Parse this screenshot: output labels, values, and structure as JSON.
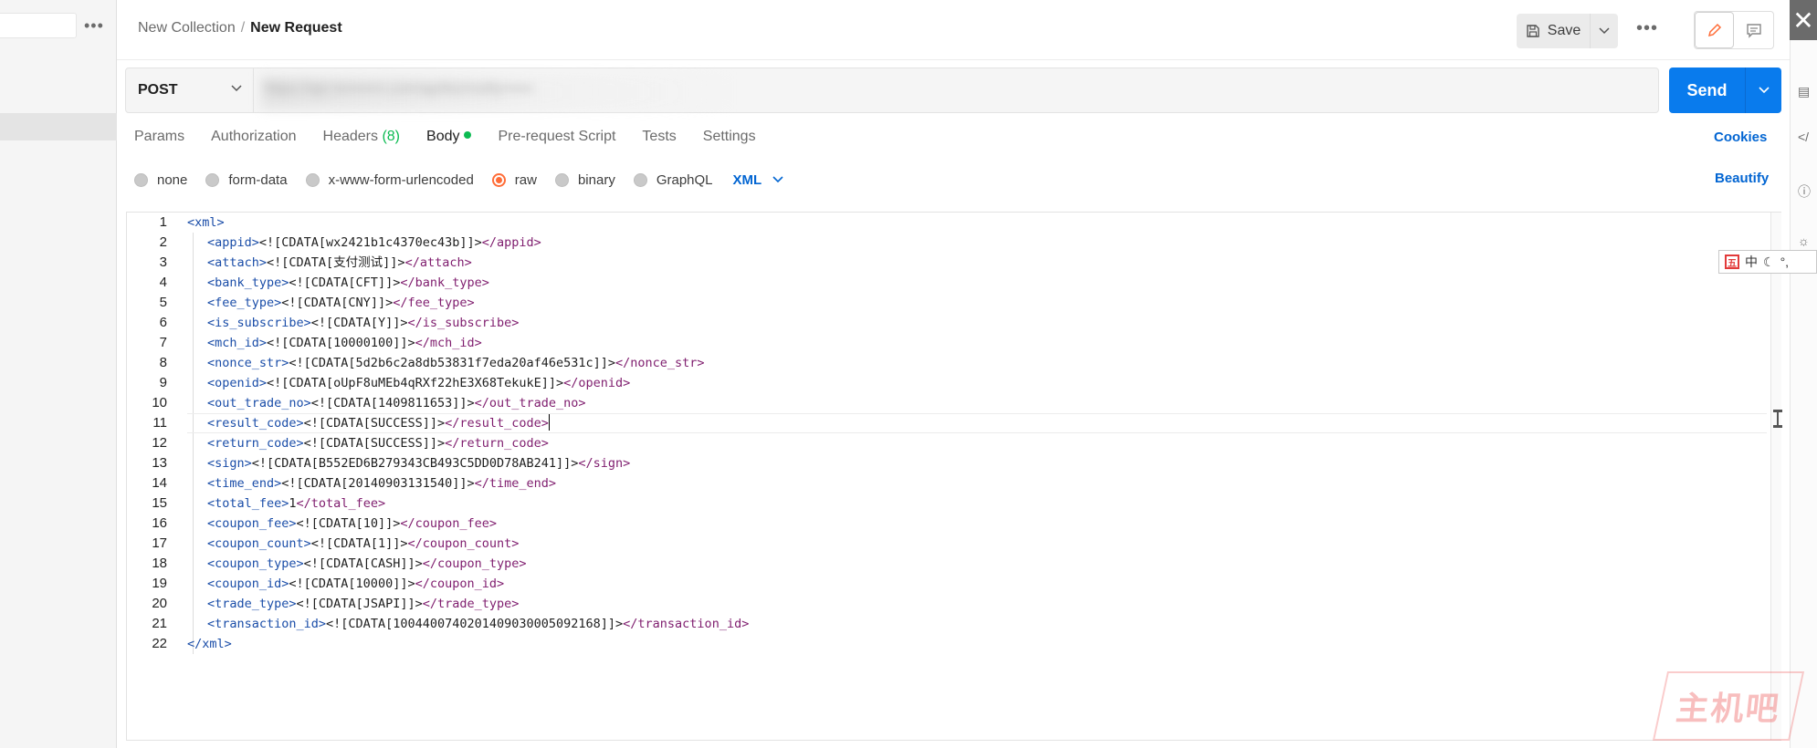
{
  "header": {
    "breadcrumb_parent": "New Collection",
    "breadcrumb_sep": "/",
    "breadcrumb_current": "New Request",
    "save_label": "Save",
    "more_label": "•••"
  },
  "request": {
    "method": "POST",
    "url": "https://api.m••••••••.com/api/biz/notify••••••",
    "send_label": "Send"
  },
  "tabs": [
    {
      "label": "Params"
    },
    {
      "label": "Authorization"
    },
    {
      "label": "Headers",
      "count": "(8)"
    },
    {
      "label": "Body"
    },
    {
      "label": "Pre-request Script"
    },
    {
      "label": "Tests"
    },
    {
      "label": "Settings"
    }
  ],
  "links": {
    "cookies": "Cookies",
    "beautify": "Beautify"
  },
  "body_types": {
    "none": "none",
    "form_data": "form-data",
    "urlencoded": "x-www-form-urlencoded",
    "raw": "raw",
    "binary": "binary",
    "graphql": "GraphQL",
    "format": "XML",
    "selected": "raw"
  },
  "editor": {
    "line_numbers": [
      "1",
      "2",
      "3",
      "4",
      "5",
      "6",
      "7",
      "8",
      "9",
      "10",
      "11",
      "12",
      "13",
      "14",
      "15",
      "16",
      "17",
      "18",
      "19",
      "20",
      "21",
      "22"
    ],
    "lines": [
      {
        "open": "<xml>",
        "text": "",
        "close": ""
      },
      {
        "open": "<appid>",
        "text": "<![CDATA[wx2421b1c4370ec43b]]>",
        "close": "</appid>"
      },
      {
        "open": "<attach>",
        "text": "<![CDATA[支付测试]]>",
        "close": "</attach>"
      },
      {
        "open": "<bank_type>",
        "text": "<![CDATA[CFT]]>",
        "close": "</bank_type>"
      },
      {
        "open": "<fee_type>",
        "text": "<![CDATA[CNY]]>",
        "close": "</fee_type>"
      },
      {
        "open": "<is_subscribe>",
        "text": "<![CDATA[Y]]>",
        "close": "</is_subscribe>"
      },
      {
        "open": "<mch_id>",
        "text": "<![CDATA[10000100]]>",
        "close": "</mch_id>"
      },
      {
        "open": "<nonce_str>",
        "text": "<![CDATA[5d2b6c2a8db53831f7eda20af46e531c]]>",
        "close": "</nonce_str>"
      },
      {
        "open": "<openid>",
        "text": "<![CDATA[oUpF8uMEb4qRXf22hE3X68TekukE]]>",
        "close": "</openid>"
      },
      {
        "open": "<out_trade_no>",
        "text": "<![CDATA[1409811653]]>",
        "close": "</out_trade_no>"
      },
      {
        "open": "<result_code>",
        "text": "<![CDATA[SUCCESS]]>",
        "close": "</result_code>"
      },
      {
        "open": "<return_code>",
        "text": "<![CDATA[SUCCESS]]>",
        "close": "</return_code>"
      },
      {
        "open": "<sign>",
        "text": "<![CDATA[B552ED6B279343CB493C5DD0D78AB241]]>",
        "close": "</sign>"
      },
      {
        "open": "<time_end>",
        "text": "<![CDATA[20140903131540]]>",
        "close": "</time_end>"
      },
      {
        "open": "<total_fee>",
        "text": "1",
        "close": "</total_fee>"
      },
      {
        "open": "<coupon_fee>",
        "text": "<![CDATA[10]]>",
        "close": "</coupon_fee>"
      },
      {
        "open": "<coupon_count>",
        "text": "<![CDATA[1]]>",
        "close": "</coupon_count>"
      },
      {
        "open": "<coupon_type>",
        "text": "<![CDATA[CASH]]>",
        "close": "</coupon_type>"
      },
      {
        "open": "<coupon_id>",
        "text": "<![CDATA[10000]]>",
        "close": "</coupon_id>"
      },
      {
        "open": "<trade_type>",
        "text": "<![CDATA[JSAPI]]>",
        "close": "</trade_type>"
      },
      {
        "open": "<transaction_id>",
        "text": "<![CDATA[1004400740201409030005092168]]>",
        "close": "</transaction_id>"
      },
      {
        "open": "",
        "text": "",
        "close": "</xml>"
      }
    ]
  },
  "ime": {
    "lang": "中",
    "punct": "°,"
  },
  "watermark": {
    "text": "主机吧"
  },
  "colors": {
    "accent": "#097bed",
    "link": "#0265d2",
    "radio_selected": "#ff6c37",
    "body_dot": "#0cbb52"
  }
}
